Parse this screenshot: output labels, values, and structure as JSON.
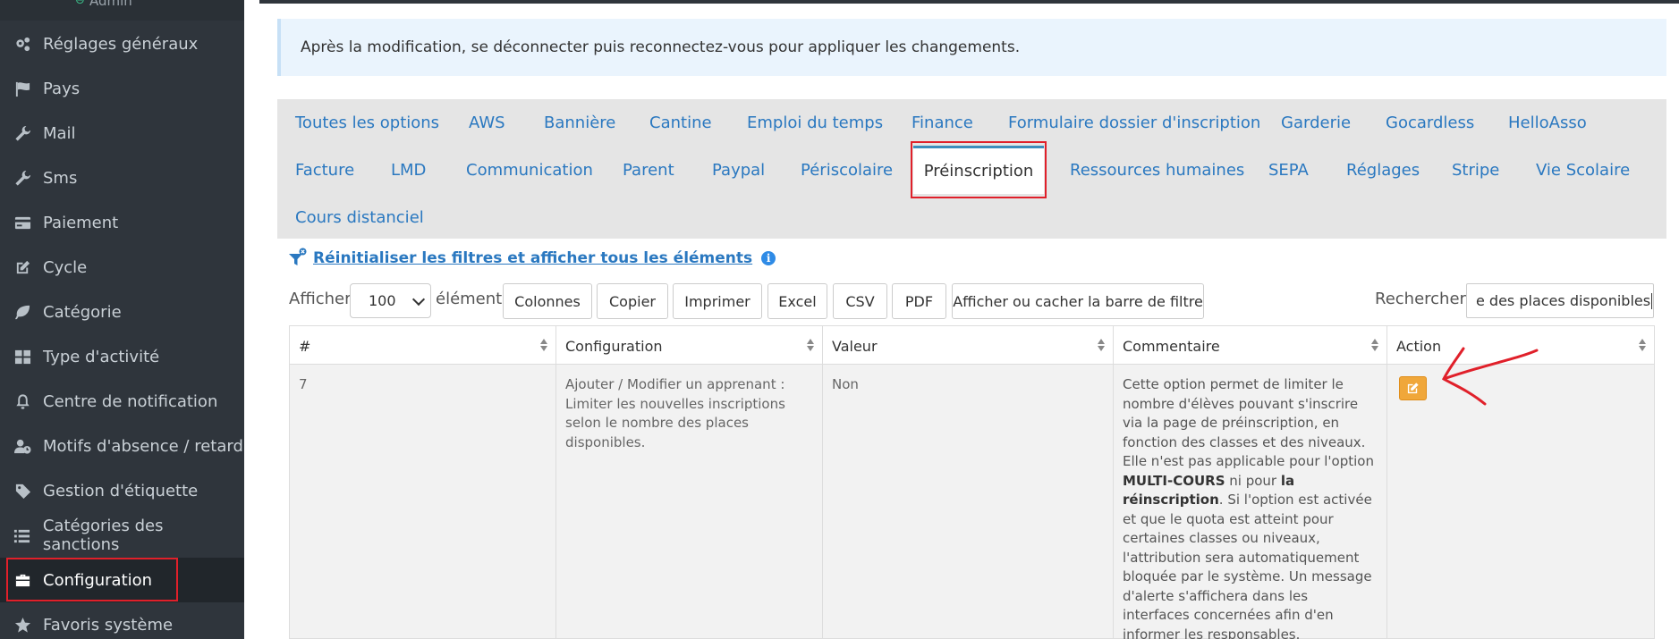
{
  "sidebar": {
    "user": {
      "status_icon": "user-status-icon",
      "name": "Admin"
    },
    "items": [
      {
        "label": "Réglages généraux",
        "icon": "cogs-icon"
      },
      {
        "label": "Pays",
        "icon": "flag-icon"
      },
      {
        "label": "Mail",
        "icon": "wrench-icon"
      },
      {
        "label": "Sms",
        "icon": "wrench-icon"
      },
      {
        "label": "Paiement",
        "icon": "credit-card-icon"
      },
      {
        "label": "Cycle",
        "icon": "edit-icon"
      },
      {
        "label": "Catégorie",
        "icon": "leaf-icon"
      },
      {
        "label": "Type d'activité",
        "icon": "grid-icon"
      },
      {
        "label": "Centre de notification",
        "icon": "bell-icon"
      },
      {
        "label": "Motifs d'absence / retard",
        "icon": "user-clock-icon"
      },
      {
        "label": "Gestion d'étiquette",
        "icon": "tag-icon"
      },
      {
        "label": "Catégories des sanctions",
        "icon": "list-icon"
      },
      {
        "label": "Configuration",
        "icon": "briefcase-icon",
        "active": true
      },
      {
        "label": "Favoris système",
        "icon": "star-icon"
      }
    ]
  },
  "alert": {
    "text": "Après la modification, se déconnecter puis reconnectez-vous pour appliquer les changements."
  },
  "tabs": {
    "row1": [
      "Toutes les options",
      "AWS",
      "Bannière",
      "Cantine",
      "Emploi du temps",
      "Finance",
      "Formulaire dossier d'inscription",
      "Garderie",
      "Gocardless",
      "HelloAsso"
    ],
    "row2": [
      "Facture",
      "LMD",
      "Communication",
      "Parent",
      "Paypal",
      "Périscolaire",
      "Préinscription",
      "Ressources humaines",
      "SEPA",
      "Réglages",
      "Stripe",
      "Vie Scolaire"
    ],
    "row3": [
      "Cours distanciel"
    ],
    "active": "Préinscription"
  },
  "filters": {
    "reset_label": "Réinitialiser les filtres et afficher tous les éléments",
    "info": "i"
  },
  "toolbar": {
    "show_label": "Afficher",
    "length_value": "100",
    "entries_label": "éléments",
    "buttons": [
      "Colonnes",
      "Copier",
      "Imprimer",
      "Excel",
      "CSV",
      "PDF",
      "Afficher ou cacher la barre de filtre"
    ],
    "search_label": "Rechercher :",
    "search_value": "e des places disponibles"
  },
  "table": {
    "headers": [
      "#",
      "Configuration",
      "Valeur",
      "Commentaire",
      "Action"
    ],
    "row": {
      "id": "7",
      "configuration": "Ajouter / Modifier un apprenant : Limiter les nouvelles inscriptions selon le nombre des places disponibles.",
      "valeur": "Non",
      "commentaire": {
        "p1": "Cette option permet de limiter le nombre d'élèves pouvant s'inscrire via la page de préinscription, en fonction des classes et des niveaux. Elle n'est pas applicable pour l'option ",
        "b1": "MULTI-COURS",
        "p2": " ni pour ",
        "b2": "la réinscription",
        "p3": ". Si l'option est activée et que le quota est atteint pour certaines classes ou niveaux, l'attribution sera automatiquement bloquée par le système. Un message d'alerte s'affichera dans les interfaces concernées afin d'en informer les responsables."
      }
    }
  },
  "colors": {
    "sidebar_bg": "#2f353c",
    "link": "#2a78c0",
    "highlight": "#e0202a",
    "edit_button": "#f0a73a",
    "tabs_bg": "#e5e5e5"
  }
}
